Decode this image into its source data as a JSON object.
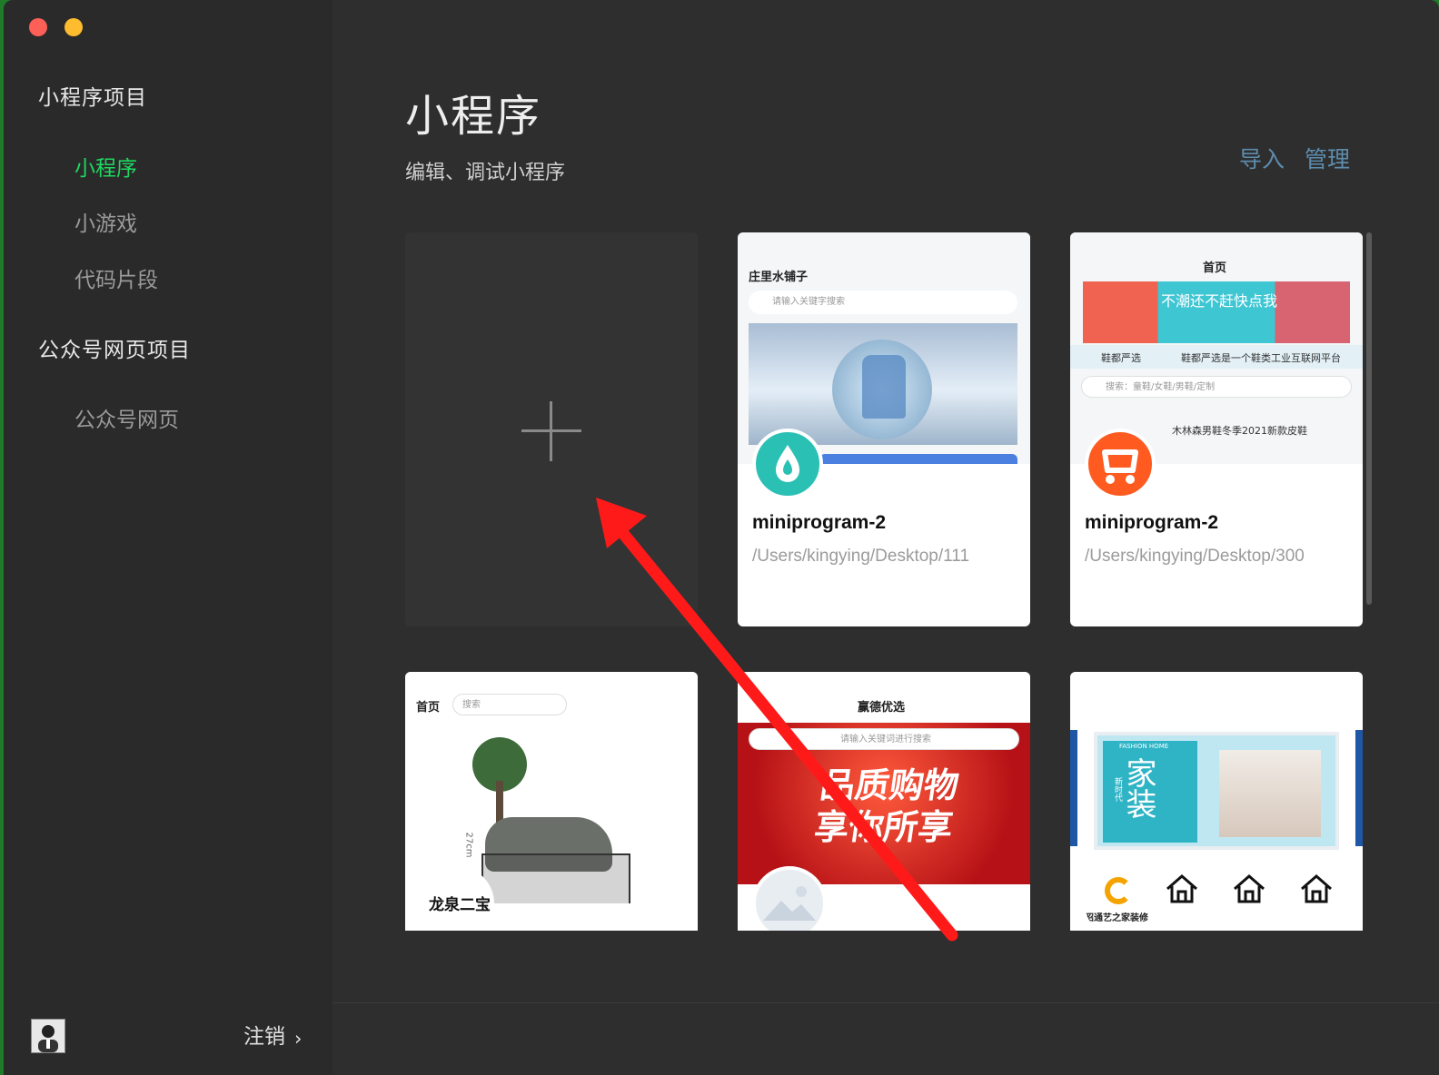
{
  "sidebar": {
    "section_miniprogram": "小程序项目",
    "nav_miniprogram": "小程序",
    "nav_minigame": "小游戏",
    "nav_snippet": "代码片段",
    "section_webpage": "公众号网页项目",
    "nav_webpage": "公众号网页",
    "logout": "注销",
    "logout_chevron": "›"
  },
  "header": {
    "title": "小程序",
    "subtitle": "编辑、调试小程序",
    "import_label": "导入",
    "manage_label": "管理"
  },
  "new_project": {
    "plus_icon": "plus-icon"
  },
  "projects": [
    {
      "name": "miniprogram-2",
      "path": "/Users/kingying/Desktop/111",
      "preview": {
        "title": "庄里水铺子",
        "search": "请输入关键字搜索"
      },
      "icon": "water-drop-icon",
      "icon_color": "#2bc0b4"
    },
    {
      "name": "miniprogram-2",
      "path": "/Users/kingying/Desktop/300",
      "preview": {
        "title": "首页",
        "banner_text": "不潮还不赶快点我",
        "notice_left": "鞋都严选",
        "notice_right": "鞋都严选是一个鞋类工业互联网平台",
        "search": "搜索：童鞋/女鞋/男鞋/定制",
        "product": "木林森男鞋冬季2021新款皮鞋"
      },
      "icon": "shopping-cart-icon",
      "icon_color": "#ff5a1f"
    },
    {
      "preview": {
        "title": "首页",
        "search": "搜索",
        "logo_text": "龙泉二宝",
        "measure": "27cm"
      },
      "icon": "calligraphy-logo-icon"
    },
    {
      "preview": {
        "title": "赢德优选",
        "search": "请输入关键词进行搜索",
        "banner": "品质购物 享你所享"
      },
      "icon": "image-placeholder-icon"
    },
    {
      "preview": {
        "banner_big": "家装",
        "banner_small": "新时代",
        "banner_en": "FASHION HOME",
        "logo_text": "昭通艺之家装修"
      },
      "icon": "brand-logo-icon"
    }
  ],
  "colors": {
    "accent": "#1ed760",
    "link": "#5d8cad",
    "annotation_arrow": "#ff1a1a"
  }
}
